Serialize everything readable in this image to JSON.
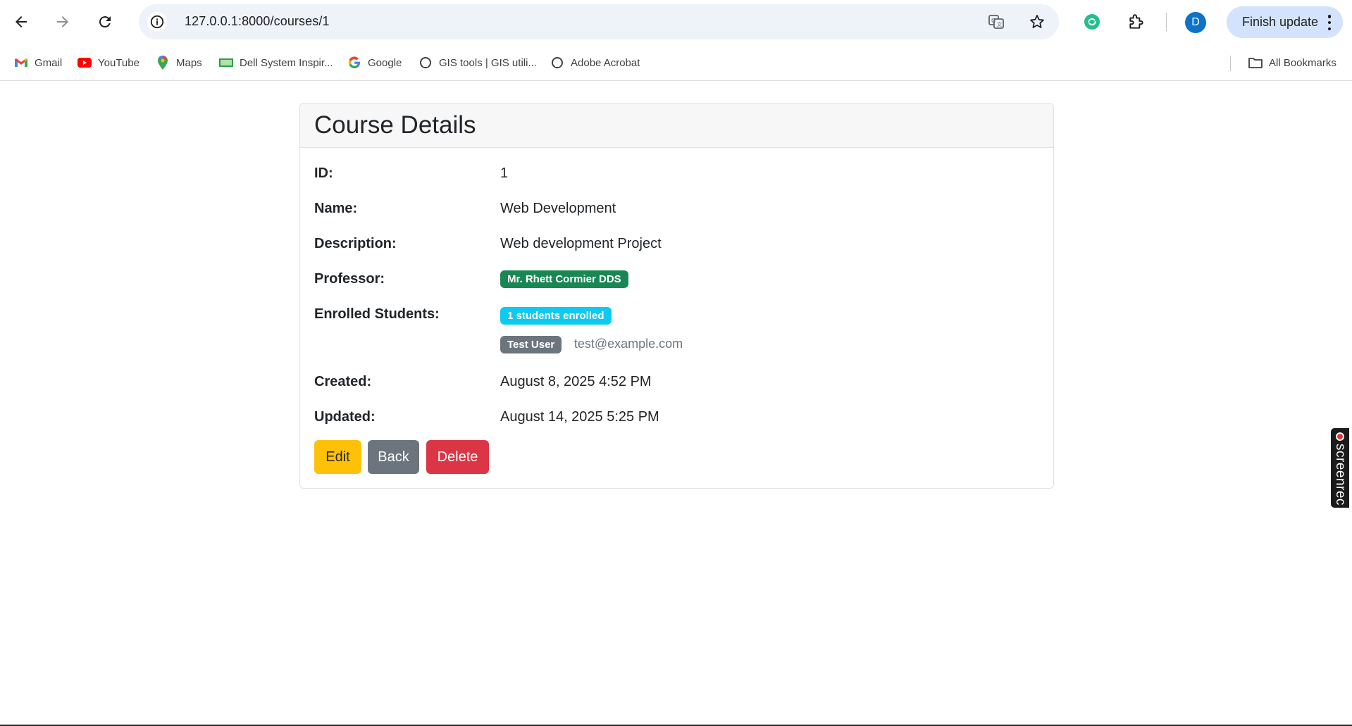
{
  "browser": {
    "url": "127.0.0.1:8000/courses/1",
    "avatar_letter": "D",
    "finish_update_label": "Finish update",
    "bookmarks": [
      {
        "label": "Gmail",
        "icon": "gmail-icon"
      },
      {
        "label": "YouTube",
        "icon": "youtube-icon"
      },
      {
        "label": "Maps",
        "icon": "maps-icon"
      },
      {
        "label": "Dell System Inspir...",
        "icon": "dell-icon"
      },
      {
        "label": "Google",
        "icon": "google-icon"
      },
      {
        "label": "GIS tools | GIS utili...",
        "icon": "github-icon"
      },
      {
        "label": "Adobe Acrobat",
        "icon": "github-icon"
      }
    ],
    "all_bookmarks_label": "All Bookmarks"
  },
  "course": {
    "title": "Course Details",
    "id_label": "ID:",
    "id_value": "1",
    "name_label": "Name:",
    "name_value": "Web Development",
    "description_label": "Description:",
    "description_value": "Web development Project",
    "professor_label": "Professor:",
    "professor_value": "Mr. Rhett Cormier DDS",
    "enrolled_label": "Enrolled Students:",
    "enrolled_badge": "1 students enrolled",
    "students": [
      {
        "name": "Test User",
        "email": "test@example.com"
      }
    ],
    "created_label": "Created:",
    "created_value": "August 8, 2025 4:52 PM",
    "updated_label": "Updated:",
    "updated_value": "August 14, 2025 5:25 PM"
  },
  "actions": {
    "edit_label": "Edit",
    "back_label": "Back",
    "delete_label": "Delete"
  },
  "screenrec": {
    "label": "screenrec"
  },
  "colors": {
    "professor_badge": "#198754",
    "enrolled_badge": "#0dcaf0",
    "student_badge": "#6c757d",
    "edit_button": "#ffc107",
    "back_button": "#6c757d",
    "delete_button": "#dc3545"
  }
}
